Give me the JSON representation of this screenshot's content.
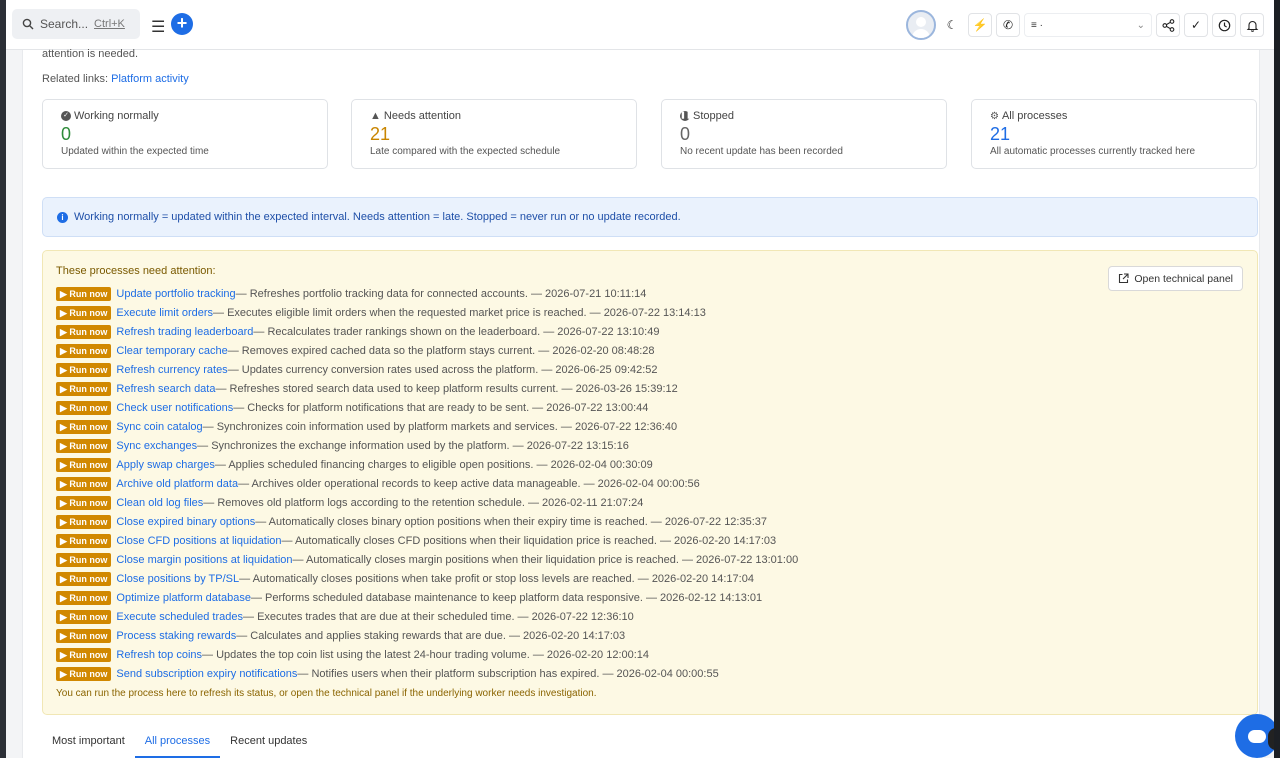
{
  "topbar": {
    "search_placeholder": "Search...",
    "search_shortcut": "Ctrl+K",
    "menu_icon": "menu-icon",
    "add_icon": "plus-icon",
    "select_value": "≡ ·",
    "icons": [
      "moon-icon",
      "bolt-icon",
      "phone-icon",
      "share-icon",
      "check-icon",
      "clock-icon",
      "bell-icon"
    ]
  },
  "page": {
    "faded_text": "attention is needed.",
    "related_label": "Related links:",
    "related_link": "Platform activity"
  },
  "cards": [
    {
      "label": "Working normally",
      "value": "0",
      "sub": "Updated within the expected time",
      "color": "#2e8b3a",
      "icon": "check-circle-icon"
    },
    {
      "label": "Needs attention",
      "value": "21",
      "sub": "Late compared with the expected schedule",
      "color": "#c98500",
      "icon": "warning-icon"
    },
    {
      "label": "Stopped",
      "value": "0",
      "sub": "No recent update has been recorded",
      "color": "#666666",
      "icon": "pause-icon"
    },
    {
      "label": "All processes",
      "value": "21",
      "sub": "All automatic processes currently tracked here",
      "color": "#1e6de5",
      "icon": "gears-icon"
    }
  ],
  "info": {
    "text": "Working normally = updated within the expected interval. Needs attention = late. Stopped = never run or no update recorded."
  },
  "attention": {
    "heading": "These processes need attention:",
    "tech_button": "Open technical panel",
    "run_label": "▶ Run now",
    "footnote": "You can run the process here to refresh its status, or open the technical panel if the underlying worker needs investigation.",
    "rows": [
      {
        "name": "Update portfolio tracking",
        "desc": " — Refreshes portfolio tracking data for connected accounts. — 2026-07-21 10:11:14"
      },
      {
        "name": "Execute limit orders",
        "desc": " — Executes eligible limit orders when the requested market price is reached. — 2026-07-22 13:14:13"
      },
      {
        "name": "Refresh trading leaderboard",
        "desc": " — Recalculates trader rankings shown on the leaderboard. — 2026-07-22 13:10:49"
      },
      {
        "name": "Clear temporary cache",
        "desc": " — Removes expired cached data so the platform stays current. — 2026-02-20 08:48:28"
      },
      {
        "name": "Refresh currency rates",
        "desc": " — Updates currency conversion rates used across the platform. — 2026-06-25 09:42:52"
      },
      {
        "name": "Refresh search data",
        "desc": " — Refreshes stored search data used to keep platform results current. — 2026-03-26 15:39:12"
      },
      {
        "name": "Check user notifications",
        "desc": " — Checks for platform notifications that are ready to be sent. — 2026-07-22 13:00:44"
      },
      {
        "name": "Sync coin catalog",
        "desc": " — Synchronizes coin information used by platform markets and services. — 2026-07-22 12:36:40"
      },
      {
        "name": "Sync exchanges",
        "desc": " — Synchronizes the exchange information used by the platform. — 2026-07-22 13:15:16"
      },
      {
        "name": "Apply swap charges",
        "desc": " — Applies scheduled financing charges to eligible open positions. — 2026-02-04 00:30:09"
      },
      {
        "name": "Archive old platform data",
        "desc": " — Archives older operational records to keep active data manageable. — 2026-02-04 00:00:56"
      },
      {
        "name": "Clean old log files",
        "desc": " — Removes old platform logs according to the retention schedule. — 2026-02-11 21:07:24"
      },
      {
        "name": "Close expired binary options",
        "desc": " — Automatically closes binary option positions when their expiry time is reached. — 2026-07-22 12:35:37"
      },
      {
        "name": "Close CFD positions at liquidation",
        "desc": " — Automatically closes CFD positions when their liquidation price is reached. — 2026-02-20 14:17:03"
      },
      {
        "name": "Close margin positions at liquidation",
        "desc": " — Automatically closes margin positions when their liquidation price is reached. — 2026-07-22 13:01:00"
      },
      {
        "name": "Close positions by TP/SL",
        "desc": " — Automatically closes positions when take profit or stop loss levels are reached. — 2026-02-20 14:17:04"
      },
      {
        "name": "Optimize platform database",
        "desc": " — Performs scheduled database maintenance to keep platform data responsive. — 2026-02-12 14:13:01"
      },
      {
        "name": "Execute scheduled trades",
        "desc": " — Executes trades that are due at their scheduled time. — 2026-07-22 12:36:10"
      },
      {
        "name": "Process staking rewards",
        "desc": " — Calculates and applies staking rewards that are due. — 2026-02-20 14:17:03"
      },
      {
        "name": "Refresh top coins",
        "desc": " — Updates the top coin list using the latest 24-hour trading volume. — 2026-02-20 12:00:14"
      },
      {
        "name": "Send subscription expiry notifications",
        "desc": " — Notifies users when their platform subscription has expired. — 2026-02-04 00:00:55"
      }
    ]
  },
  "tabs": [
    {
      "label": "Most important",
      "active": false
    },
    {
      "label": "All processes",
      "active": true
    },
    {
      "label": "Recent updates",
      "active": false
    }
  ]
}
